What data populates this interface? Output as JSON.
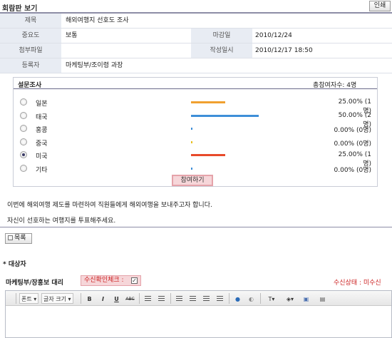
{
  "header": {
    "title": "회람판 보기",
    "print_label": "인쇄"
  },
  "info": {
    "subject_label": "제목",
    "subject_value": "해외여행지 선호도 조사",
    "importance_label": "중요도",
    "importance_value": "보통",
    "deadline_label": "마감일",
    "deadline_value": "2010/12/24",
    "attachment_label": "첨부파일",
    "attachment_value": "",
    "created_label": "작성일시",
    "created_value": "2010/12/17 18:50",
    "registrant_label": "등록자",
    "registrant_value": "마케팅부/조이령 과장"
  },
  "survey": {
    "title": "설문조사",
    "total": "총참여자수: 4명",
    "options": [
      {
        "label": "일본",
        "pct": 25,
        "pct_text": "25.00% (1명)",
        "color": "#f0a030",
        "selected": false
      },
      {
        "label": "태국",
        "pct": 50,
        "pct_text": "50.00% (2명)",
        "color": "#3e8fd8",
        "selected": false
      },
      {
        "label": "홍콩",
        "pct": 0,
        "pct_text": "0.00% (0명)",
        "color": "#3e8fd8",
        "selected": false
      },
      {
        "label": "중국",
        "pct": 0,
        "pct_text": "0.00% (0명)",
        "color": "#e8c020",
        "selected": false
      },
      {
        "label": "미국",
        "pct": 25,
        "pct_text": "25.00% (1명)",
        "color": "#e84a2a",
        "selected": true
      },
      {
        "label": "기타",
        "pct": 0,
        "pct_text": "0.00% (0명)",
        "color": "#3e8fd8",
        "selected": false
      }
    ],
    "join_label": "참여하기"
  },
  "description": {
    "line1": "이번에 해외여행 제도를 마련하여 직원들에게 해외여행을 보내주고자 합니다.",
    "line2": "자신이 선호하는 여행지를 투표해주세요."
  },
  "list_label": "목록",
  "target": {
    "title": "* 대상자",
    "recipient_name": "마케팅부/장홍보 대리",
    "check_label": "수신확인체크 :",
    "check_mark": "✓",
    "status_text": "수신상태 : 미수신"
  },
  "toolbar": {
    "font_label": "폰트",
    "size_label": "글자 크기",
    "bold": "B",
    "italic": "I",
    "underline": "U",
    "strike": "ABC"
  }
}
